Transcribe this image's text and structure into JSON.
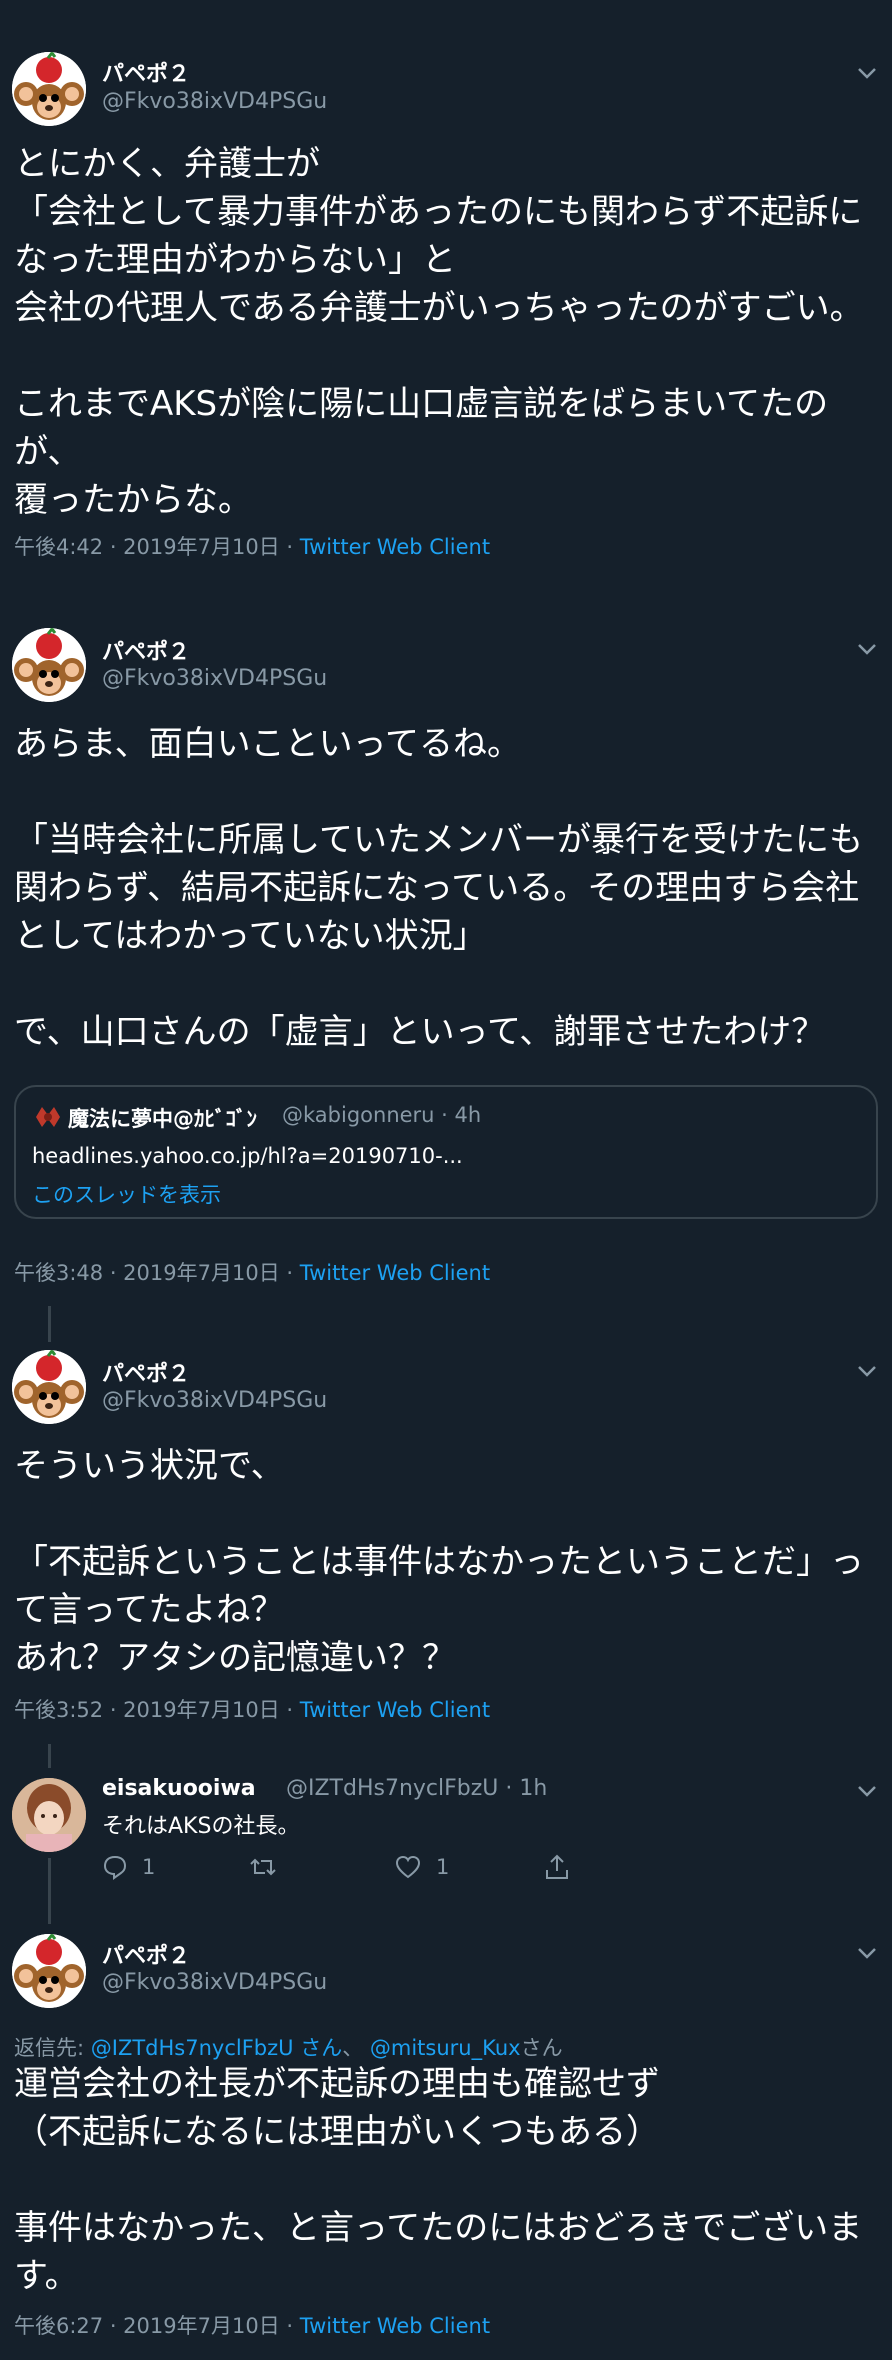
{
  "tweets": [
    {
      "name": "パペポ２",
      "handle": "@Fkvo38ixVD4PSGu",
      "text": "とにかく、弁護士が\n「会社として暴力事件があったのにも関わらず不起訴に\nなった理由がわからない」と\n会社の代理人である弁護士がいっちゃったのがすごい。\n\nこれまでAKSが陰に陽に山口虚言説をばらまいてたの\nが、\n覆ったからな。",
      "time": "午後4:42 · 2019年7月10日 · ",
      "source": "Twitter Web Client"
    },
    {
      "name": "パペポ２",
      "handle": "@Fkvo38ixVD4PSGu",
      "text": "あらま、面白いこといってるね。\n\n「当時会社に所属していたメンバーが暴行を受けたにも\n関わらず、結局不起訴になっている。その理由すら会社\nとしてはわかっていない状況」\n\nで、山口さんの「虚言」といって、謝罪させたわけ？",
      "time": "午後3:48 · 2019年7月10日 · ",
      "source": "Twitter Web Client",
      "quote": {
        "name": "魔法に夢中@ｶﾋﾞｺﾞﾝ",
        "handle": "@kabigonneru · 4h",
        "url": "headlines.yahoo.co.jp/hl?a=20190710-...",
        "link": "このスレッドを表示"
      }
    },
    {
      "name": "パペポ２",
      "handle": "@Fkvo38ixVD4PSGu",
      "text": "そういう状況で、\n\n「不起訴ということは事件はなかったということだ」っ\nて言ってたよね？\nあれ？アタシの記憶違い？？",
      "time": "午後3:52 · 2019年7月10日 · ",
      "source": "Twitter Web Client"
    },
    {
      "name": "パペポ２",
      "handle": "@Fkvo38ixVD4PSGu",
      "reply_prefix": "返信先: ",
      "reply_mention1": "@IZTdHs7nyclFbzU さん",
      "reply_sep": "、 ",
      "reply_mention2": "@mitsuru_Kux",
      "reply_suffix": "さん",
      "text": "運営会社の社長が不起訴の理由も確認せず\n（不起訴になるには理由がいくつもある）\n\n事件はなかった、と言ってたのにはおどろきでございま\nす。",
      "time": "午後6:27 · 2019年7月10日 · ",
      "source": "Twitter Web Client"
    }
  ],
  "reply": {
    "name": "eisakuooiwa",
    "handle": "@IZTdHs7nyclFbzU · 1h",
    "text": "それはAKSの社長。",
    "reply_count": "1",
    "like_count": "1"
  },
  "colors": {
    "background": "#15202b",
    "secondary_text": "#8899a6",
    "link": "#1da1f2",
    "border": "#38444d"
  }
}
